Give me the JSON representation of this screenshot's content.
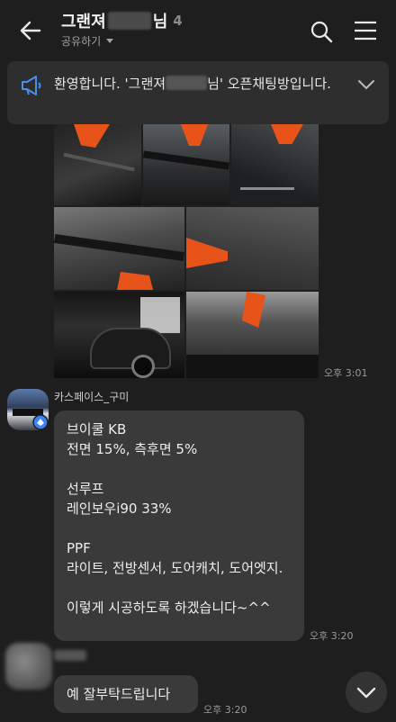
{
  "header": {
    "title_prefix": "그랜져",
    "title_suffix": "님",
    "member_count": "4",
    "share_label": "공유하기",
    "back_icon": "back-arrow-icon",
    "search_icon": "search-icon",
    "menu_icon": "hamburger-menu-icon"
  },
  "notice": {
    "text_before": "환영합니다. '그랜져",
    "text_after": "님' 오픈채팅방입니다.",
    "icon": "megaphone-icon"
  },
  "photo_message": {
    "time": "오후 3:01"
  },
  "message1": {
    "sender": "카스페이스_구미",
    "text": "브이쿨 KB\n전면 15%, 측후면 5%\n\n선루프\n레인보우i90 33%\n\nPPF\n라이트, 전방센서, 도어캐치, 도어엣지.\n\n이렇게 시공하도록 하겠습니다~^^",
    "time": "오후 3:20"
  },
  "message2": {
    "text": "예 잘부탁드립니다",
    "time": "오후 3:20"
  },
  "colors": {
    "background": "#1e1e1e",
    "bubble": "#3a3a3a",
    "notice_bg": "#2e2e2e",
    "accent_orange": "#e8531a",
    "verified_badge": "#3b82f6"
  }
}
